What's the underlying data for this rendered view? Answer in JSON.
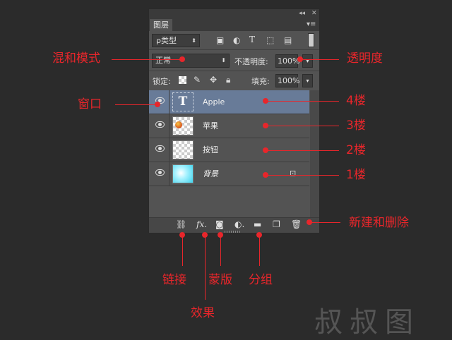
{
  "panel": {
    "tab_label": "图层",
    "filter_label": "ρ类型",
    "blend_mode": "正常",
    "opacity_label": "不透明度:",
    "opacity_value": "100%",
    "lock_label": "锁定:",
    "fill_label": "填充:",
    "fill_value": "100%",
    "topbar_collapse": "◂◂",
    "topbar_close": "✕",
    "menu_icon": "▾≡"
  },
  "layers": [
    {
      "name": "Apple",
      "type": "text",
      "selected": true
    },
    {
      "name": "苹果",
      "type": "image",
      "selected": false
    },
    {
      "name": "按钮",
      "type": "image",
      "selected": false
    },
    {
      "name": "背景",
      "type": "background",
      "selected": false,
      "locked": true
    }
  ],
  "annotations": {
    "blend_mode": "混和模式",
    "opacity": "透明度",
    "window": "窗口",
    "floor4": "4楼",
    "floor3": "3楼",
    "floor2": "2楼",
    "floor1": "1楼",
    "new_delete": "新建和删除",
    "link": "链接",
    "effect": "效果",
    "mask": "蒙版",
    "group": "分组"
  },
  "colors": {
    "annotation": "#e8262b",
    "selected_row": "#687b98",
    "panel_bg": "#535353"
  },
  "watermark": "叔叔图"
}
